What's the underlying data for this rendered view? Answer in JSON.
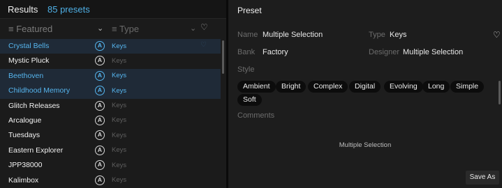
{
  "results": {
    "label": "Results",
    "count": "85 presets"
  },
  "columns": {
    "featured": "≡ Featured",
    "featured_chevron": "⌄",
    "type": "≡ Type",
    "type_chevron": "⌄",
    "favorite_icon": "♡"
  },
  "presets": [
    {
      "name": "Crystal Bells",
      "logo": "A",
      "type": "Keys",
      "selected": true
    },
    {
      "name": "Mystic Pluck",
      "logo": "A",
      "type": "Keys",
      "selected": false
    },
    {
      "name": "Beethoven",
      "logo": "A",
      "type": "Keys",
      "selected": true
    },
    {
      "name": "Childhood Memory",
      "logo": "A",
      "type": "Keys",
      "selected": true
    },
    {
      "name": "Glitch Releases",
      "logo": "A",
      "type": "Keys",
      "selected": false
    },
    {
      "name": "Arcalogue",
      "logo": "A",
      "type": "Keys",
      "selected": false
    },
    {
      "name": "Tuesdays",
      "logo": "A",
      "type": "Keys",
      "selected": false
    },
    {
      "name": "Eastern Explorer",
      "logo": "A",
      "type": "Keys",
      "selected": false
    },
    {
      "name": "JPP38000",
      "logo": "A",
      "type": "Keys",
      "selected": false
    },
    {
      "name": "Kalimbox",
      "logo": "A",
      "type": "Keys",
      "selected": false
    }
  ],
  "preset_panel": {
    "title": "Preset",
    "name_label": "Name",
    "name_value": "Multiple Selection",
    "type_label": "Type",
    "type_value": "Keys",
    "bank_label": "Bank",
    "bank_value": "Factory",
    "designer_label": "Designer",
    "designer_value": "Multiple Selection",
    "style_label": "Style",
    "tags": [
      "Ambient",
      "Bright",
      "Complex",
      "Digital",
      "Evolving",
      "Long",
      "Simple",
      "Soft"
    ],
    "comments_label": "Comments",
    "comments_value": "Multiple Selection",
    "save_as_label": "Save As",
    "favorite_icon": "♡"
  },
  "colors": {
    "accent": "#56b5ee",
    "selected_row_bg": "#1f2a37",
    "panel_bg": "#1d1d1d",
    "list_bg": "#1b1b1b"
  }
}
